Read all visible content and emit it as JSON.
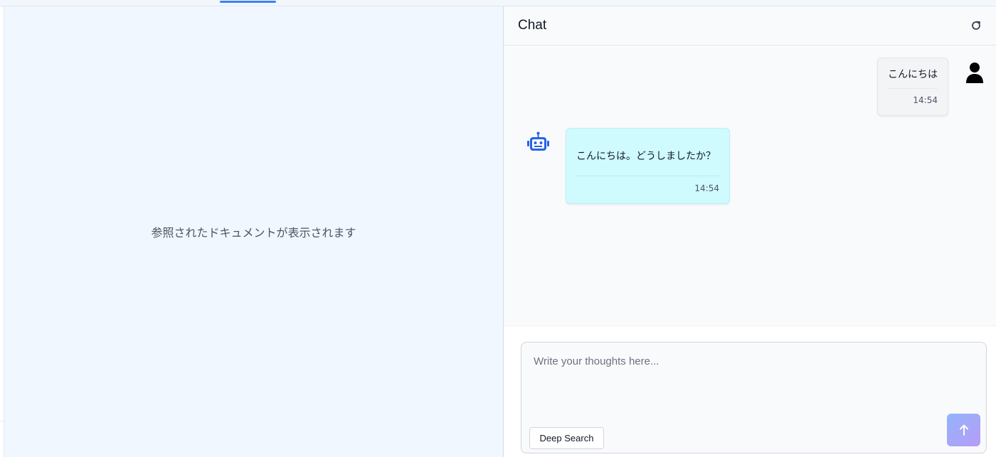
{
  "document_pane": {
    "placeholder": "参照されたドキュメントが表示されます"
  },
  "chat": {
    "title": "Chat",
    "refresh_icon": "refresh-icon",
    "messages": [
      {
        "role": "user",
        "text": "こんにちは",
        "time": "14:54",
        "icon": "user-icon"
      },
      {
        "role": "assistant",
        "text": "こんにちは。どうしましたか？",
        "time": "14:54",
        "icon": "robot-icon"
      }
    ],
    "composer": {
      "placeholder": "Write your thoughts here...",
      "deep_search_label": "Deep Search",
      "send_icon": "arrow-up-icon"
    }
  },
  "colors": {
    "accent": "#3b82f6",
    "user_bubble": "#f3f4f6",
    "bot_bubble": "#cffafe",
    "document_bg": "#f0f7ff",
    "send_gradient_start": "#93b4fb",
    "send_gradient_end": "#b69cf7"
  }
}
